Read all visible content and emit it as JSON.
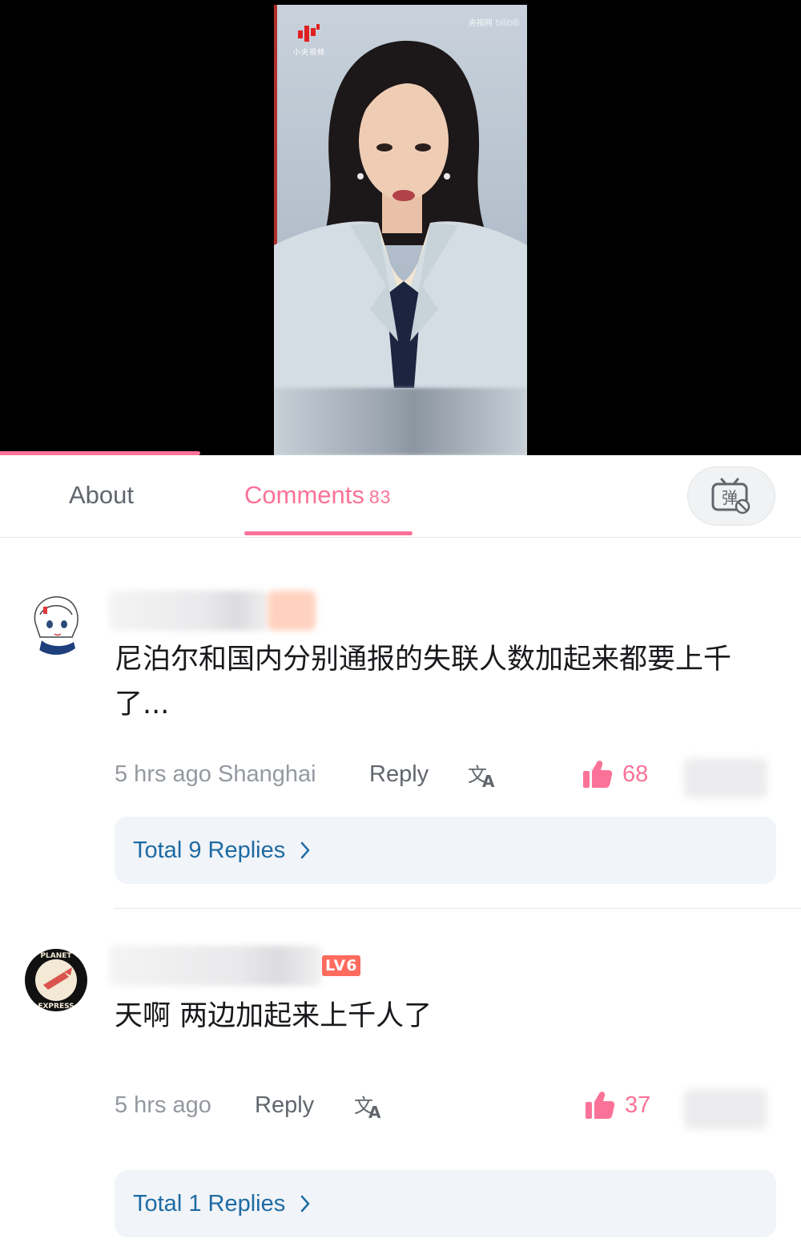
{
  "video": {
    "channel_logo_text": "小央视频",
    "watermark_text": "央视网",
    "watermark_brand": "bilibili",
    "progress": 0.25
  },
  "tabs": {
    "about_label": "About",
    "comments_label": "Comments",
    "comments_count": "83",
    "danmaku_icon": "danmaku-toggle-icon"
  },
  "comments": [
    {
      "avatar_icon": "anime-girl-avatar",
      "text": "尼泊尔和国内分别通报的失联人数加起来都要上千了...",
      "time": "5 hrs ago",
      "location": "Shanghai",
      "reply_label": "Reply",
      "translate_icon": "translate-icon",
      "like_icon": "thumbs-up-icon",
      "likes": "68",
      "replies_label": "Total 9 Replies"
    },
    {
      "avatar_icon": "planet-express-avatar",
      "level_badge": "LV6",
      "text": "天啊 两边加起来上千人了",
      "time": "5 hrs ago",
      "reply_label": "Reply",
      "translate_icon": "translate-icon",
      "like_icon": "thumbs-up-icon",
      "likes": "37",
      "replies_label": "Total 1 Replies"
    }
  ],
  "colors": {
    "accent": "#fb7299",
    "link": "#1e6ba3",
    "muted": "#9499a0"
  }
}
